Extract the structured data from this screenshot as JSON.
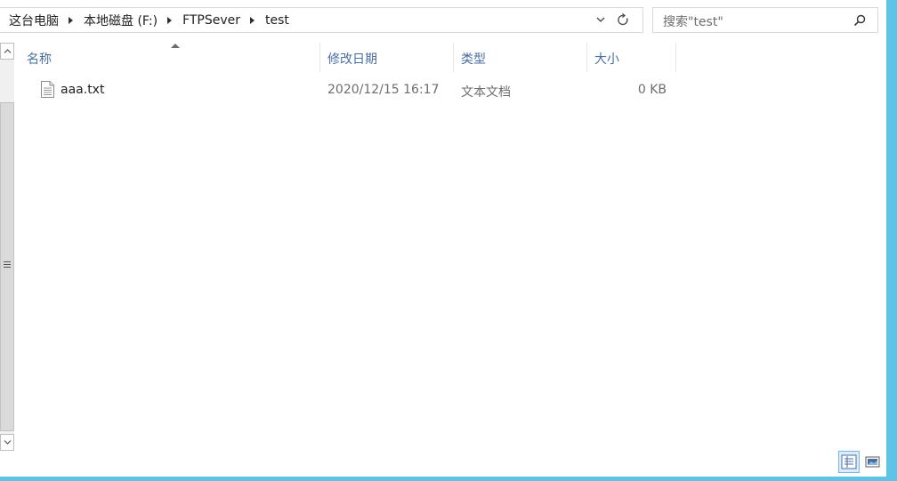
{
  "breadcrumb": {
    "items": [
      {
        "label": "这台电脑"
      },
      {
        "label": "本地磁盘 (F:)"
      },
      {
        "label": "FTPSever"
      },
      {
        "label": "test"
      }
    ]
  },
  "search": {
    "placeholder": "搜索\"test\""
  },
  "columns": {
    "name": "名称",
    "date": "修改日期",
    "type": "类型",
    "size": "大小"
  },
  "files": [
    {
      "name": "aaa.txt",
      "modified": "2020/12/15 16:17",
      "type": "文本文档",
      "size": "0 KB",
      "icon": "text-file-icon"
    }
  ],
  "icons": {
    "address_dropdown": "chevron-down-icon",
    "refresh": "refresh-icon",
    "search": "search-icon",
    "view_details": "details-view-icon",
    "view_thumbnails": "large-icons-view-icon"
  },
  "colors": {
    "frame": "#5fc3e6",
    "header_text": "#4a6ea0",
    "selected_view_bg": "#dcecfa"
  }
}
